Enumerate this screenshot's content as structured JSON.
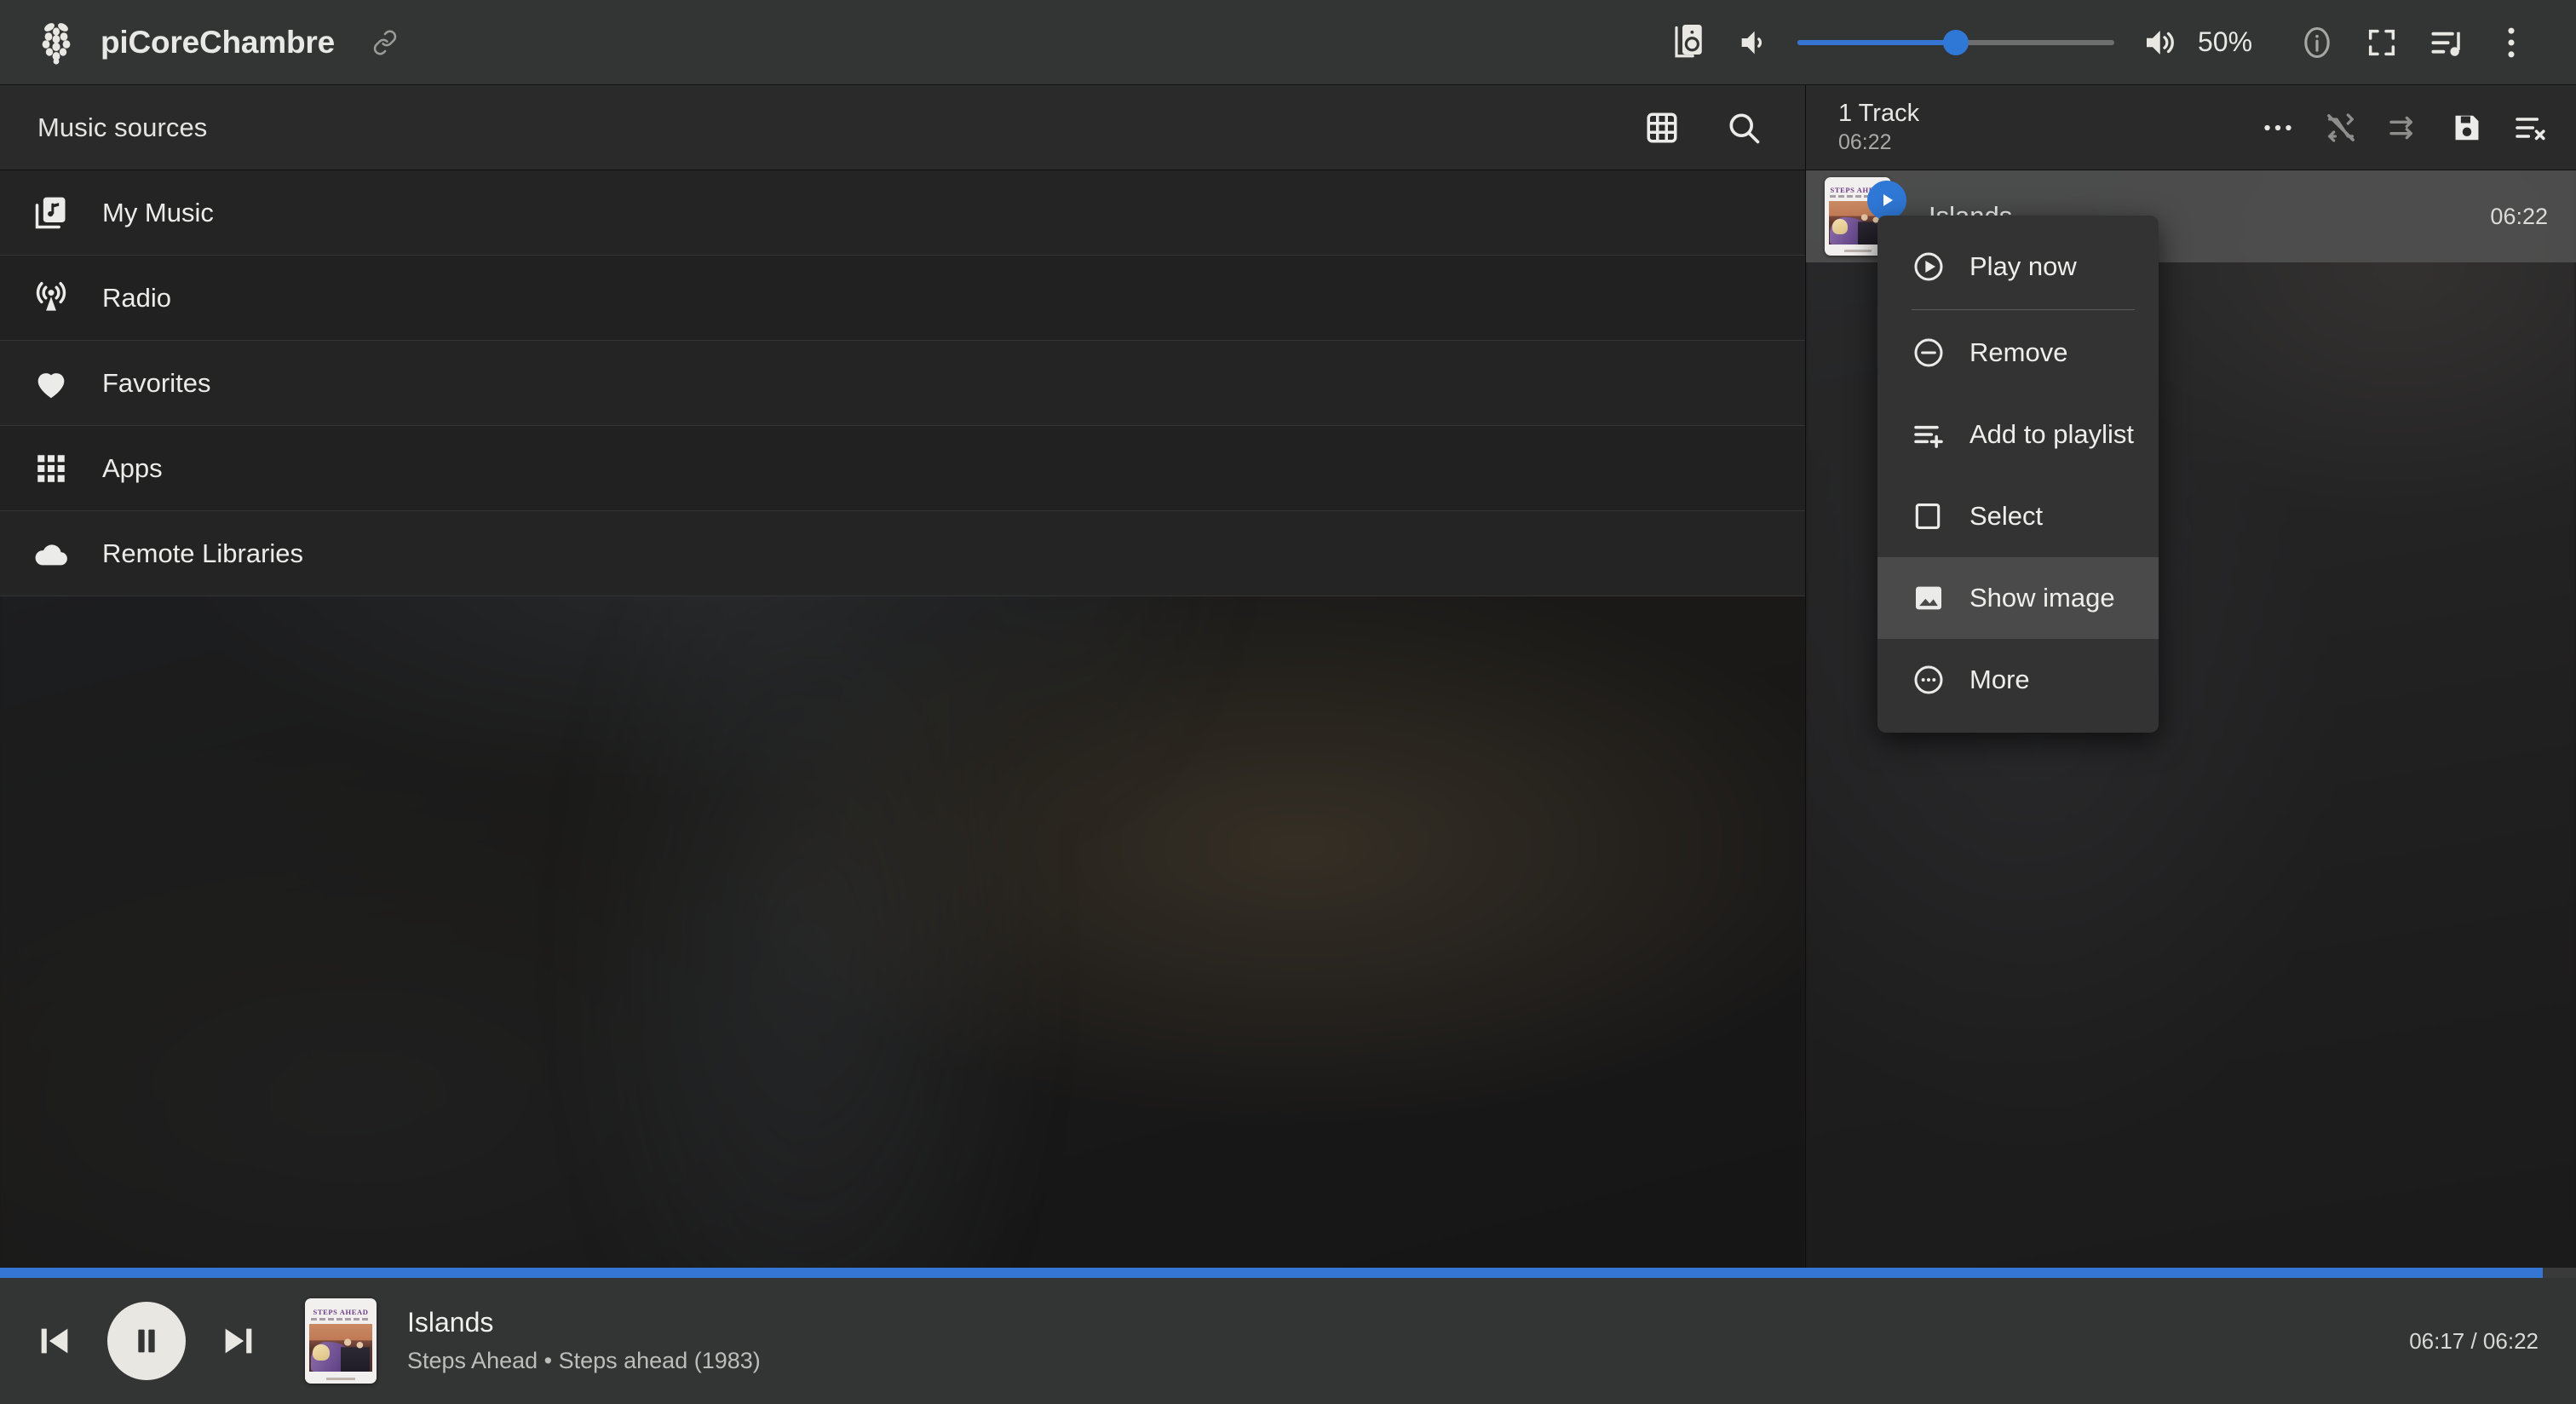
{
  "topbar": {
    "logo_icon": "raspberry-pi-logo",
    "title": "piCoreChambre",
    "link_icon": "link-icon",
    "zone_icon": "speaker-zone-icon",
    "volume_down_icon": "volume-down-icon",
    "volume_up_icon": "volume-up-icon",
    "volume_percent": "50%",
    "volume_value": 50,
    "info_icon": "info-icon",
    "fullscreen_icon": "fullscreen-icon",
    "queue_icon": "playlist-queue-icon",
    "overflow_icon": "vertical-dots-icon"
  },
  "sources": {
    "header_title": "Music sources",
    "grid_icon": "grid-view-icon",
    "search_icon": "search-icon",
    "items": [
      {
        "label": "My Music",
        "icon": "music-library-icon"
      },
      {
        "label": "Radio",
        "icon": "radio-broadcast-icon"
      },
      {
        "label": "Favorites",
        "icon": "heart-icon"
      },
      {
        "label": "Apps",
        "icon": "apps-grid-icon"
      },
      {
        "label": "Remote Libraries",
        "icon": "cloud-icon"
      }
    ]
  },
  "playlist": {
    "count_label": "1 Track",
    "duration_label": "06:22",
    "more_icon": "horizontal-dots-icon",
    "shuffle_icon": "shuffle-off-icon",
    "repeat_icon": "repeat-off-icon",
    "save_icon": "save-floppy-icon",
    "clear_icon": "clear-playlist-icon",
    "tracks": [
      {
        "title": "Islands",
        "duration": "06:22",
        "album_art_title": "STEPS AHEAD",
        "playing_badge_icon": "play-badge-icon"
      }
    ]
  },
  "context_menu": {
    "items": [
      {
        "label": "Play now",
        "icon": "play-circle-icon",
        "highlighted": false
      },
      {
        "label": "Remove",
        "icon": "minus-circle-icon",
        "highlighted": false
      },
      {
        "label": "Add to playlist",
        "icon": "playlist-add-icon",
        "highlighted": false
      },
      {
        "label": "Select",
        "icon": "checkbox-empty-icon",
        "highlighted": false
      },
      {
        "label": "Show image",
        "icon": "image-icon",
        "highlighted": true
      },
      {
        "label": "More",
        "icon": "more-circle-icon",
        "highlighted": false
      }
    ]
  },
  "player": {
    "previous_icon": "skip-previous-icon",
    "play_pause_icon": "pause-icon",
    "next_icon": "skip-next-icon",
    "album_art_title": "STEPS AHEAD",
    "track_title": "Islands",
    "track_subtitle": "Steps Ahead • Steps ahead (1983)",
    "time_display": "06:17 / 06:22",
    "progress_percent": 98.7,
    "progress_color": "#3576d4"
  },
  "colors": {
    "accent": "#3576d4",
    "topbar_bg": "#333434",
    "panel_bg": "#2a2a2a",
    "row_bg": "#242424",
    "menu_bg": "#333333",
    "menu_highlight": "#4a4a4a",
    "text_primary": "#ececea",
    "text_secondary": "#a9a9a7"
  }
}
